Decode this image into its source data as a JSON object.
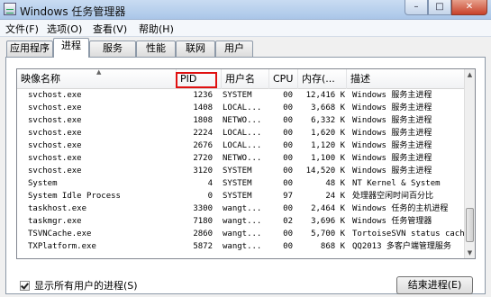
{
  "window": {
    "title": "Windows 任务管理器",
    "controls": {
      "minimize": "–",
      "maximize": "□",
      "close": "✕"
    }
  },
  "menu": [
    "文件(F)",
    "选项(O)",
    "查看(V)",
    "帮助(H)"
  ],
  "tabs": [
    "应用程序",
    "进程",
    "服务",
    "性能",
    "联网",
    "用户"
  ],
  "active_tab": "进程",
  "columns": [
    "映像名称",
    "PID",
    "用户名",
    "CPU",
    "内存(...",
    "描述"
  ],
  "processes": [
    {
      "name": "svchost.exe",
      "pid": "1236",
      "user": "SYSTEM",
      "cpu": "00",
      "mem": "12,416 K",
      "desc": "Windows 服务主进程"
    },
    {
      "name": "svchost.exe",
      "pid": "1408",
      "user": "LOCAL...",
      "cpu": "00",
      "mem": "3,668 K",
      "desc": "Windows 服务主进程"
    },
    {
      "name": "svchost.exe",
      "pid": "1808",
      "user": "NETWO...",
      "cpu": "00",
      "mem": "6,332 K",
      "desc": "Windows 服务主进程"
    },
    {
      "name": "svchost.exe",
      "pid": "2224",
      "user": "LOCAL...",
      "cpu": "00",
      "mem": "1,620 K",
      "desc": "Windows 服务主进程"
    },
    {
      "name": "svchost.exe",
      "pid": "2676",
      "user": "LOCAL...",
      "cpu": "00",
      "mem": "1,120 K",
      "desc": "Windows 服务主进程"
    },
    {
      "name": "svchost.exe",
      "pid": "2720",
      "user": "NETWO...",
      "cpu": "00",
      "mem": "1,100 K",
      "desc": "Windows 服务主进程"
    },
    {
      "name": "svchost.exe",
      "pid": "3120",
      "user": "SYSTEM",
      "cpu": "00",
      "mem": "14,520 K",
      "desc": "Windows 服务主进程"
    },
    {
      "name": "System",
      "pid": "4",
      "user": "SYSTEM",
      "cpu": "00",
      "mem": "48 K",
      "desc": "NT Kernel & System"
    },
    {
      "name": "System Idle Process",
      "pid": "0",
      "user": "SYSTEM",
      "cpu": "97",
      "mem": "24 K",
      "desc": "处理器空闲时间百分比"
    },
    {
      "name": "taskhost.exe",
      "pid": "3300",
      "user": "wangt...",
      "cpu": "00",
      "mem": "2,464 K",
      "desc": "Windows 任务的主机进程"
    },
    {
      "name": "taskmgr.exe",
      "pid": "7180",
      "user": "wangt...",
      "cpu": "02",
      "mem": "3,696 K",
      "desc": "Windows 任务管理器"
    },
    {
      "name": "TSVNCache.exe",
      "pid": "2860",
      "user": "wangt...",
      "cpu": "00",
      "mem": "5,700 K",
      "desc": "TortoiseSVN status cach"
    },
    {
      "name": "TXPlatform.exe",
      "pid": "5872",
      "user": "wangt...",
      "cpu": "00",
      "mem": "868 K",
      "desc": "QQ2013 多客户端管理服务"
    }
  ],
  "show_all_users_label": "显示所有用户的进程(S)",
  "end_process_label": "结束进程(E)",
  "icons": {
    "app": "task-manager-icon",
    "checkbox": "checkbox-checked"
  }
}
